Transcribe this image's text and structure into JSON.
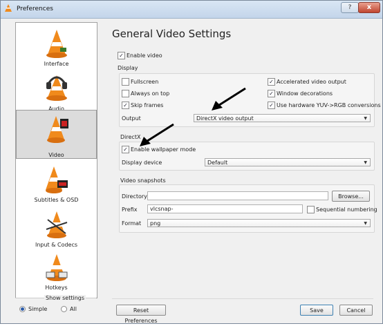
{
  "window": {
    "title": "Preferences",
    "help": "?",
    "close": "x"
  },
  "sidebar": {
    "items": [
      {
        "label": "Interface"
      },
      {
        "label": "Audio"
      },
      {
        "label": "Video"
      },
      {
        "label": "Subtitles & OSD"
      },
      {
        "label": "Input & Codecs"
      },
      {
        "label": "Hotkeys"
      }
    ],
    "show_settings": "Show settings",
    "simple": "Simple",
    "all": "All",
    "selected_mode": "Simple"
  },
  "main": {
    "heading": "General Video Settings",
    "enable_video": "Enable video",
    "display": {
      "title": "Display",
      "fullscreen": "Fullscreen",
      "always_on_top": "Always on top",
      "skip_frames": "Skip frames",
      "accelerated": "Accelerated video output",
      "window_decorations": "Window decorations",
      "hw_yuv": "Use hardware YUV->RGB conversions",
      "output_label": "Output",
      "output_value": "DirectX video output"
    },
    "directx": {
      "title": "DirectX",
      "wallpaper": "Enable wallpaper mode",
      "display_device_label": "Display device",
      "display_device_value": "Default"
    },
    "snapshots": {
      "title": "Video snapshots",
      "directory_label": "Directory",
      "directory_value": "",
      "browse": "Browse...",
      "prefix_label": "Prefix",
      "prefix_value": "vlcsnap-",
      "sequential": "Sequential numbering",
      "format_label": "Format",
      "format_value": "png"
    }
  },
  "footer": {
    "reset": "Reset Preferences",
    "save": "Save",
    "cancel": "Cancel"
  },
  "colors": {
    "accent_orange": "#f08a1c",
    "title_gradient": "#c3d5ea"
  }
}
